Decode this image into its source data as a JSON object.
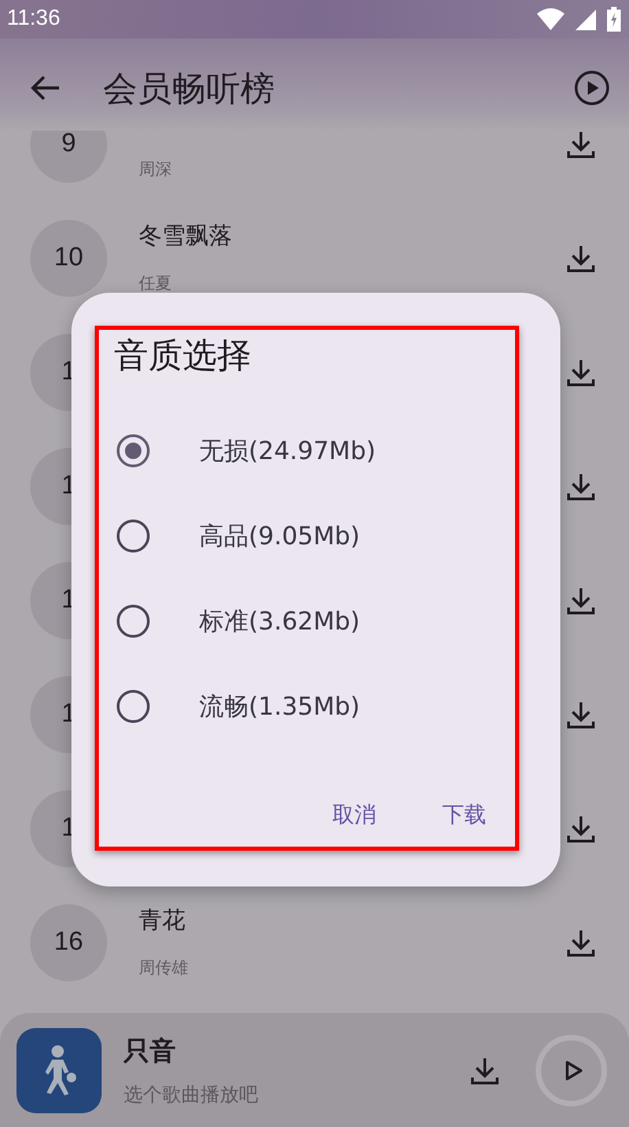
{
  "status_bar": {
    "time": "11:36"
  },
  "header": {
    "title": "会员畅听榜"
  },
  "songs": [
    {
      "rank": "9",
      "artist": "周深"
    },
    {
      "rank": "10",
      "title": "冬雪飘落",
      "artist": "任夏"
    },
    {
      "rank": "1"
    },
    {
      "rank": "1"
    },
    {
      "rank": "1"
    },
    {
      "rank": "1"
    },
    {
      "rank": "1"
    },
    {
      "rank": "16",
      "title": "青花",
      "artist": "周传雄"
    }
  ],
  "dialog": {
    "title": "音质选择",
    "options": [
      {
        "label": "无损(24.97Mb)",
        "selected": true
      },
      {
        "label": "高品(9.05Mb)",
        "selected": false
      },
      {
        "label": "标准(3.62Mb)",
        "selected": false
      },
      {
        "label": "流畅(1.35Mb)",
        "selected": false
      }
    ],
    "buttons": [
      "取消",
      "下载"
    ]
  },
  "player": {
    "title": "只音",
    "subtitle": "选个歌曲播放吧"
  }
}
